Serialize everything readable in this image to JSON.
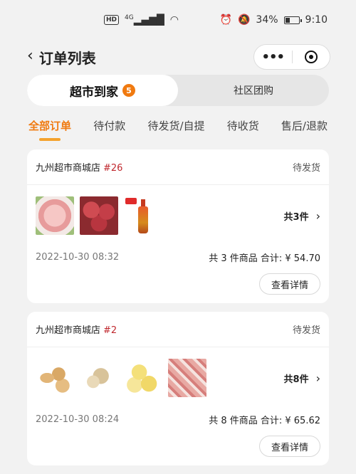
{
  "status_bar": {
    "hd": "HD",
    "network": "4G",
    "battery": "34%",
    "time": "9:10"
  },
  "nav": {
    "title": "订单列表",
    "more_icon": "•••",
    "back_icon": "chevron-left-icon"
  },
  "segment": {
    "items": [
      {
        "label": "超市到家",
        "badge": "5",
        "active": true
      },
      {
        "label": "社区团购",
        "active": false
      }
    ]
  },
  "tabs": [
    {
      "label": "全部订单",
      "active": true
    },
    {
      "label": "待付款"
    },
    {
      "label": "待发货/自提"
    },
    {
      "label": "待收货"
    },
    {
      "label": "售后/退款"
    }
  ],
  "orders": [
    {
      "store": "九州超市商城店",
      "order_no": "#26",
      "status": "待发货",
      "count_label": "共3件",
      "date": "2022-10-30 08:32",
      "summary": "共 3 件商品 合计: ¥ 54.70",
      "detail_label": "查看详情",
      "thumbs": [
        "pork-slice",
        "pork-red",
        "soy-bottle"
      ]
    },
    {
      "store": "九州超市商城店",
      "order_no": "#2",
      "status": "待发货",
      "count_label": "共8件",
      "date": "2022-10-30 08:24",
      "summary": "共 8 件商品 合计: ¥ 65.62",
      "detail_label": "查看详情",
      "thumbs": [
        "ginger",
        "lotus-root",
        "pear",
        "pork-belly"
      ]
    }
  ],
  "colors": {
    "accent": "#f07a10",
    "order_no": "#c0282e",
    "background": "#f2f2f2"
  }
}
